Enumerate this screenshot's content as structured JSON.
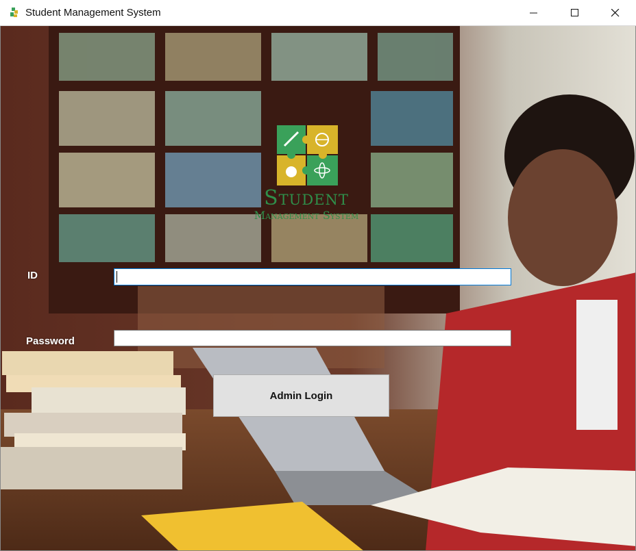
{
  "window": {
    "title": "Student Management System",
    "icon": "app-icon",
    "controls": [
      "minimize-icon",
      "maximize-icon",
      "close-icon"
    ]
  },
  "logo": {
    "line1": "Student",
    "line2": "Management System",
    "brand_green": "#2f8f4a",
    "puzzle_colors": [
      "#3aa15a",
      "#d8b42a"
    ]
  },
  "form": {
    "id_label": "ID",
    "id_value": "",
    "password_label": "Password",
    "password_value": "",
    "login_button": "Admin Login"
  }
}
